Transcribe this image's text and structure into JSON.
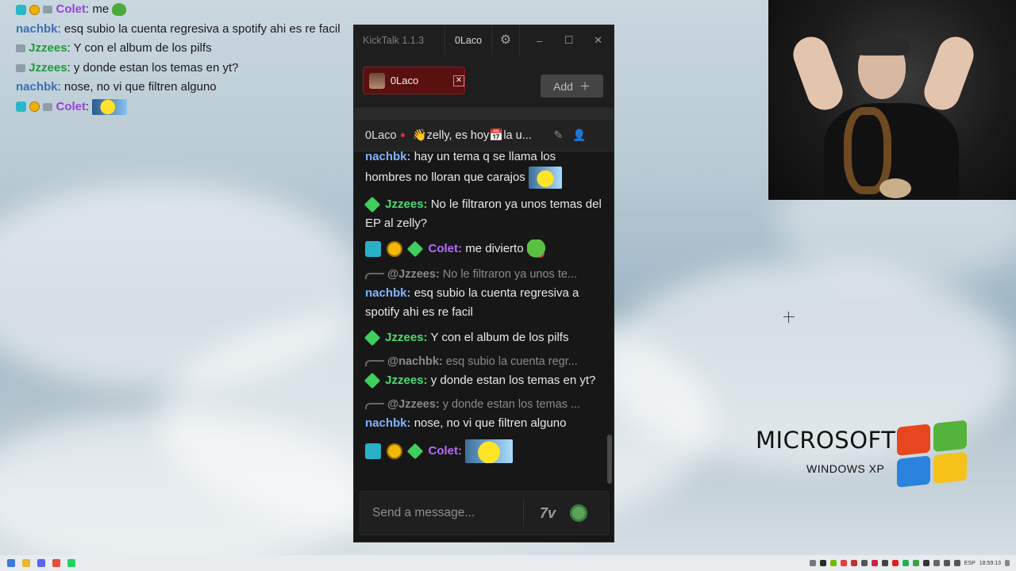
{
  "overlay_chat": [
    {
      "badges": [
        "sub",
        "one",
        "chat"
      ],
      "user": "Colet",
      "user_color": "#9b3fd1",
      "text": ": me",
      "emote": "pepe"
    },
    {
      "badges": [],
      "user": "nachbk",
      "user_color": "#3e6fb3",
      "text": ": esq subio la cuenta regresiva a spotify ahi es re facil"
    },
    {
      "badges": [
        "chat"
      ],
      "user": "Jzzees",
      "user_color": "#1f9a3e",
      "text": ": Y con el album de los pilfs"
    },
    {
      "badges": [
        "chat"
      ],
      "user": "Jzzees",
      "user_color": "#1f9a3e",
      "text": ": y donde estan los temas en yt?"
    },
    {
      "badges": [],
      "user": "nachbk",
      "user_color": "#3e6fb3",
      "text": ": nose, no vi que filtren alguno"
    },
    {
      "badges": [
        "sub",
        "one",
        "chat"
      ],
      "user": "Colet",
      "user_color": "#9b3fd1",
      "text": ":",
      "emote": "yellow"
    }
  ],
  "window": {
    "app_title": "KickTalk 1.1.3",
    "user_button": "0Laco",
    "minimize": "–",
    "maximize": "☐",
    "close": "✕"
  },
  "tabs": [
    {
      "label": "0Laco"
    }
  ],
  "add_button": "Add",
  "channel_bar": {
    "channel": "0Laco",
    "topic": "👋zelly, es hoy📅la u..."
  },
  "messages": [
    {
      "type": "msg",
      "user": "nachbk",
      "text": "hay un tema q se llama los hombres no lloran que carajos",
      "emote": "yellow"
    },
    {
      "type": "msg",
      "user": "Jzzees",
      "badges": [
        "vip"
      ],
      "text": "No le filtraron ya unos temas del EP al zelly?"
    },
    {
      "type": "msg",
      "user": "Colet",
      "badges": [
        "sub",
        "one",
        "vip"
      ],
      "text": "me divierto",
      "emote": "pepe"
    },
    {
      "type": "reply",
      "reply_user": "@Jzzees:",
      "reply_text": "No le filtraron ya unos te..."
    },
    {
      "type": "msg",
      "user": "nachbk",
      "text": "esq subio la cuenta regresiva a spotify ahi es re facil"
    },
    {
      "type": "msg",
      "user": "Jzzees",
      "badges": [
        "vip"
      ],
      "text": "Y con el album de los pilfs"
    },
    {
      "type": "reply",
      "reply_user": "@nachbk:",
      "reply_text": "esq subio la cuenta regr..."
    },
    {
      "type": "msg",
      "user": "Jzzees",
      "badges": [
        "vip"
      ],
      "text": "y donde estan los temas en yt?"
    },
    {
      "type": "reply",
      "reply_user": "@Jzzees:",
      "reply_text": "y donde estan los temas ..."
    },
    {
      "type": "msg",
      "user": "nachbk",
      "text": "nose, no vi que filtren alguno"
    },
    {
      "type": "msg",
      "user": "Colet",
      "badges": [
        "sub",
        "one",
        "vip"
      ],
      "text": "",
      "emote": "yellow-big"
    }
  ],
  "input": {
    "placeholder": "Send a message...",
    "seventv_label": "7v"
  },
  "desktop": {
    "ms_text": "MICROSOFT",
    "win_text": "WINDOWS XP"
  },
  "taskbar": {
    "lang": "ESP",
    "time": "18:59:13"
  }
}
